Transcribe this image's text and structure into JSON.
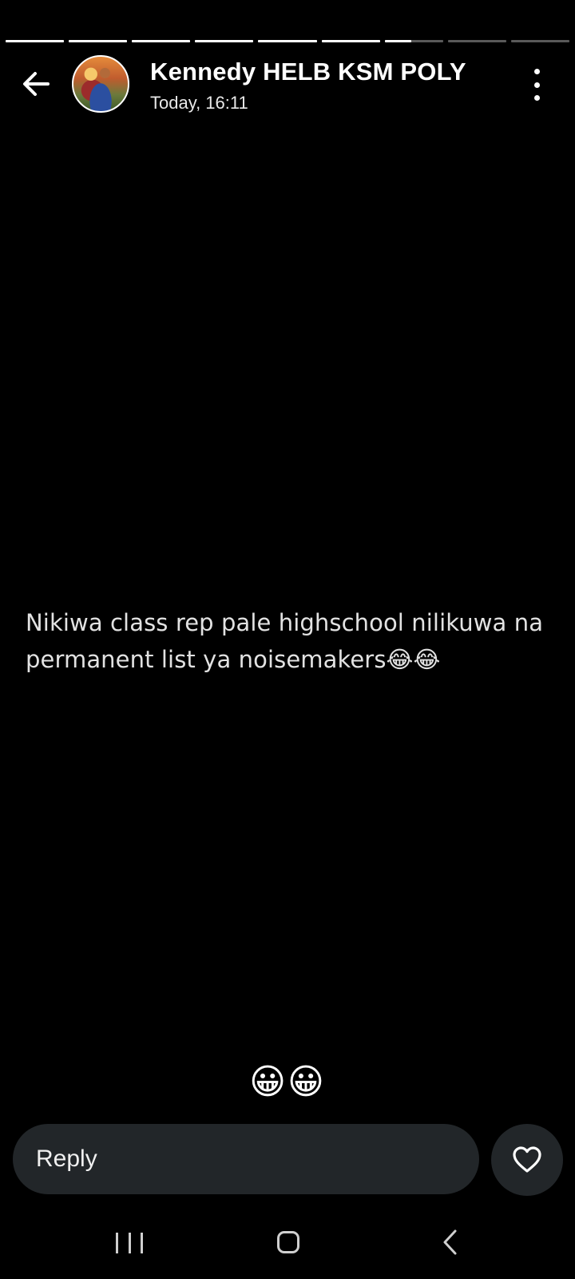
{
  "story": {
    "segments": [
      1,
      1,
      1,
      1,
      1,
      1,
      0.45,
      0,
      0
    ],
    "contact_name": "Kennedy HELB KSM POLY",
    "timestamp": "Today, 16:11",
    "status_text": "Nikiwa class rep pale highschool nilikuwa na permanent list ya noisemakers😂😂",
    "reaction": "😀😀"
  },
  "reply": {
    "label": "Reply"
  },
  "icons": {
    "back": "back-arrow-icon",
    "menu": "more-vertical-icon",
    "like": "heart-icon",
    "nav_recent": "recent-apps-icon",
    "nav_home": "home-icon",
    "nav_back": "nav-back-icon"
  },
  "colors": {
    "background": "#000000",
    "reply_surface": "#222629",
    "text": "#ffffff"
  }
}
